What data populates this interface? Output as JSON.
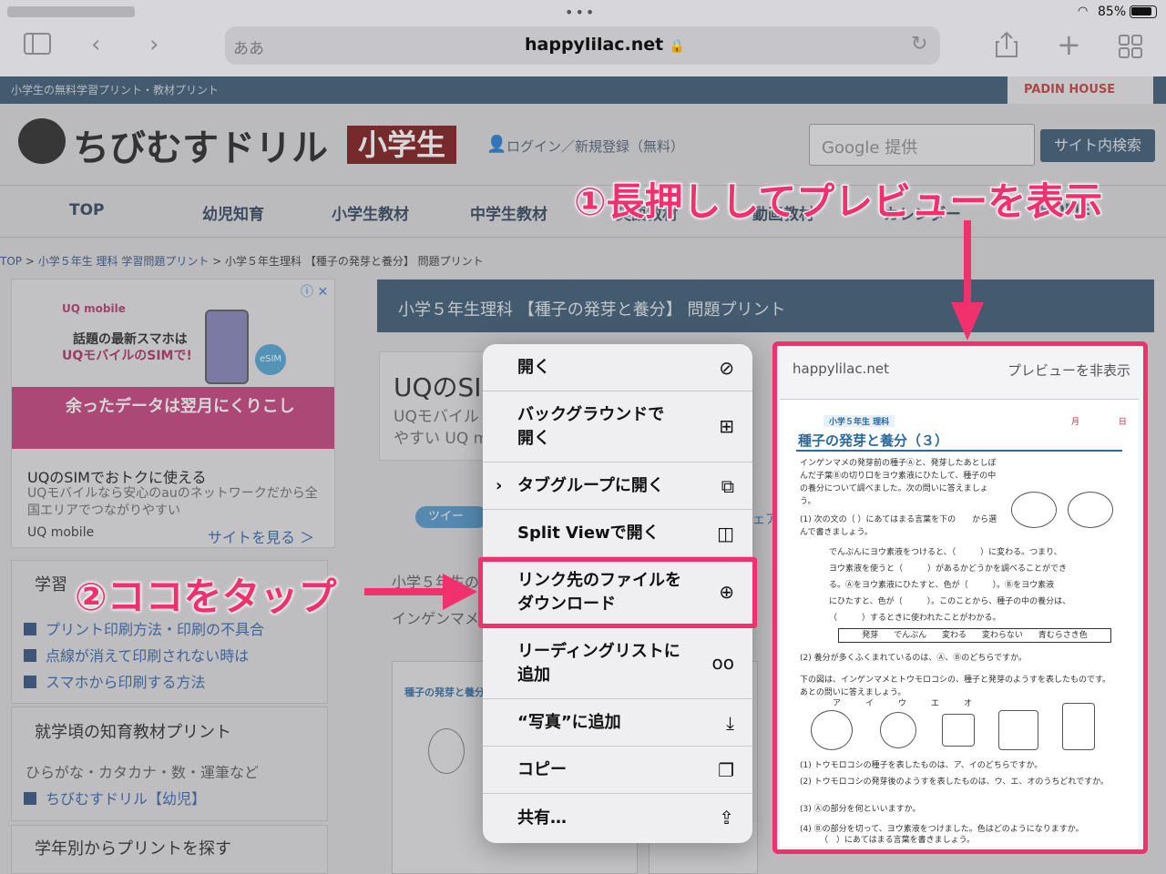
{
  "status": {
    "battery": "85%"
  },
  "browser": {
    "url_prefix": "ああ",
    "url": "happylilac.net"
  },
  "site": {
    "tagline": "小学生の無料学習プリント・教材プリント",
    "sponsor": "PADIN HOUSE",
    "logo": "ちびむすドリル",
    "logo_badge": "小学生",
    "login": "ログイン／新規登録（無料）",
    "search_placeholder": "Google 提供",
    "search_button": "サイト内検索",
    "nav": [
      "TOP",
      "幼児知育",
      "小学生教材",
      "中学生教材",
      "英語教材",
      "動画教材",
      "カレンダー",
      "HOME"
    ],
    "breadcrumb": {
      "home": "TOP",
      "sep": " > ",
      "parent": "小学５年生 理科 学習問題プリント",
      "current": "小学５年生理科 【種子の発芽と養分】 問題プリント"
    }
  },
  "ad": {
    "brand_top": "UQ mobile",
    "line1": "話題の最新スマホは",
    "line2": "UQモバイルのSIMで!",
    "esim": "eSIM",
    "pink": "余ったデータは翌月にくりこし",
    "title": "UQのSIMでおトクに使える",
    "desc": "UQモバイルなら安心のauのネットワークだから全国エリアでつながりやすい",
    "brand": "UQ mobile",
    "cta": "サイトを見る ＞"
  },
  "sidebar": {
    "box1_head": "学習",
    "links": [
      "プリント印刷方法・印刷の不具合",
      "点線が消えて印刷されない時は",
      "スマホから印刷する方法"
    ],
    "box2_head": "就学頃の知育教材プリント",
    "box2_text": "ひらがな・カタカナ・数・運筆など",
    "box2_link": "ちびむすドリル【幼児】",
    "box3_head": "学年別からプリントを探す"
  },
  "main": {
    "title": "小学５年生理科 【種子の発芽と養分】 問題プリント",
    "ad2_title": "UQのSI",
    "ad2_desc1": "UQモバイル",
    "ad2_desc2": "やすい UQ m",
    "tweet": "ツイー",
    "text1": "小学５年生の",
    "text2": "インゲンマメ",
    "thumb_title": "種子の発芽と養分",
    "frag": "ェア"
  },
  "menu": {
    "items": [
      {
        "label": "開く",
        "icon": "compass-icon"
      },
      {
        "label": "バックグラウンドで\n開く",
        "icon": "plus-square-icon"
      },
      {
        "label": "タブグループに開く",
        "icon": "arrow-square-icon"
      },
      {
        "label": "Split Viewで開く",
        "icon": "split-view-icon"
      },
      {
        "label": "リンク先のファイルを\nダウンロード",
        "icon": "download-icon"
      },
      {
        "label": "リーディングリストに\n追加",
        "icon": "glasses-icon"
      },
      {
        "label": "“写真”に追加",
        "icon": "save-icon"
      },
      {
        "label": "コピー",
        "icon": "copy-icon"
      },
      {
        "label": "共有…",
        "icon": "share-icon"
      }
    ]
  },
  "preview": {
    "domain": "happylilac.net",
    "hide": "プレビューを非表示",
    "grade": "小学５年生 理科",
    "title": "種子の発芽と養分（３）",
    "date": "月 日",
    "q1": "インゲンマメの発芽前の種子Ⓐと、発芽したあとしぼんだ子葉Ⓑの切り口をヨウ素液にひたして、種子の中の養分について調べました。次の問いに答えましょう。",
    "q1_1": "(1) 次の文の（ ）にあてはまる言葉を下の　　から選んで書きましょう。",
    "q1_text1": "でんぷんにヨウ素液をつけると、（　　　）に変わる。つまり、",
    "q1_text2": "ヨウ素液を使うと（　　　）があるかどうかを調べることができ",
    "q1_text3": "る。Ⓐをヨウ素液にひたすと、色が（　　　）。Ⓑをヨウ素液",
    "q1_text4": "にひたすと、色が（　　　）。このことから、種子の中の養分は、",
    "q1_text5": "（　　　）するときに使われたことがわかる。",
    "choices": "発芽 でんぷん 変わる 変わらない 青むらさき色",
    "q1_2": "(2) 養分が多くふくまれているのは、Ⓐ、Ⓑのどちらですか。",
    "q2": "下の図は、インゲンマメとトウモロコシの、種子と発芽のようすを表したものです。あとの問いに答えましょう。",
    "q2_labels": "ア　　　イ　　　ウ　　　エ　　　オ",
    "q2_1": "(1) トウモロコシの種子を表したものは、ア、イのどちらですか。",
    "q2_2": "(2) トウモロコシの発芽後のようすを表したものは、ウ、エ、オのうちどれですか。",
    "q2_3": "(3) Ⓐの部分を何といいますか。",
    "q2_4": "(4) Ⓑの部分を切って、ヨウ素液をつけました。色はどのようになりますか。",
    "q2_4b": "（　）にあてはまる言葉を書きましょう。"
  },
  "annotations": {
    "step1": "①長押ししてプレビューを表示",
    "step2": "②ココをタップ"
  },
  "colors": {
    "accent": "#f0316e",
    "site_navy": "#34526e"
  }
}
